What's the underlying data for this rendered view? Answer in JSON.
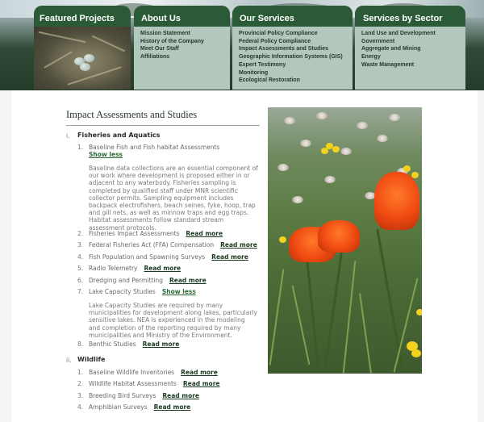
{
  "nav": {
    "featured": {
      "title": "Featured Projects"
    },
    "about": {
      "title": "About Us",
      "items": [
        "Mission Statement",
        "History of the Company",
        "Meet Our Staff",
        "Affiliations"
      ]
    },
    "services": {
      "title": "Our Services",
      "items": [
        "Provincial Policy Compliance",
        "Federal Policy Compliance",
        "Impact Assessments and Studies",
        "Geographic Information Systems (GIS)",
        "Expert Testimony",
        "Monitoring",
        "Ecological Restoration"
      ]
    },
    "sectors": {
      "title": "Services by Sector",
      "items": [
        "Land Use and Development",
        "Government",
        "Aggregate and Mining",
        "Energy",
        "Waste Management"
      ]
    }
  },
  "main": {
    "title": "Impact Assessments and Studies",
    "sections": [
      {
        "roman": "i.",
        "title": "Fisheries and Aquatics",
        "items": [
          {
            "num": "1.",
            "label": "Baseline Fish and Fish habitat Assessments",
            "link": "",
            "show_less": "Show less",
            "paragraph": "Baseline data collections are an essential component of our work where development is proposed either in or adjacent to any waterbody. Fisheries sampling is completed by qualified staff under MNR scientific collector permits. Sampling equipment includes backpack electrofishers, beach seines, fyke, hoop, trap and gill nets, as well as minnow traps and egg traps. Habitat assessments follow standard stream assessment protocols."
          },
          {
            "num": "2.",
            "label": "Fisheries Impact Assessments",
            "link": "Read more"
          },
          {
            "num": "3.",
            "label": "Federal Fisheries Act (FFA) Compensation",
            "link": "Read more"
          },
          {
            "num": "4.",
            "label": "Fish Population and Spawning Surveys",
            "link": "Read more"
          },
          {
            "num": "5.",
            "label": "Radio Telemetry",
            "link": "Read more"
          },
          {
            "num": "6.",
            "label": "Dredging and Permitting",
            "link": "Read more"
          },
          {
            "num": "7.",
            "label": "Lake Capacity Studies",
            "link": "Show less",
            "paragraph": "Lake Capacity Studies are required by many municipalities for development along lakes, particularly sensitive lakes. NEA is experienced in the modeling and completion of the reporting required by many municipalities and Ministry of the Environment."
          },
          {
            "num": "8.",
            "label": "Benthic Studies",
            "link": "Read more"
          }
        ]
      },
      {
        "roman": "ii.",
        "title": "Wildlife",
        "items": [
          {
            "num": "1.",
            "label": "Baseline Wildlife Inventories",
            "link": "Read more"
          },
          {
            "num": "2.",
            "label": "Wildlife Habitat Assessments",
            "link": "Read more"
          },
          {
            "num": "3.",
            "label": "Breeding Bird Surveys",
            "link": "Read more"
          },
          {
            "num": "4.",
            "label": "Amphibian Surveys",
            "link": "Read more"
          }
        ]
      }
    ]
  }
}
